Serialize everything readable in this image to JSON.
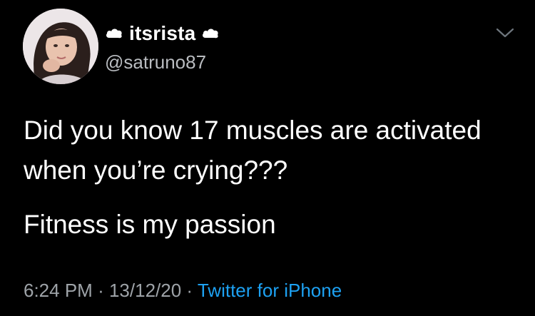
{
  "user": {
    "display_name": "itsrista",
    "handle": "@satruno87",
    "name_decoration_left": "cloud-icon",
    "name_decoration_right": "cloud-icon"
  },
  "tweet": {
    "text_lines": [
      "Did you know 17 muscles are activated",
      "when you’re crying???",
      "Fitness is my passion"
    ],
    "time": "6:24 PM",
    "separator": "·",
    "date": "13/12/20",
    "source": "Twitter for iPhone"
  },
  "icons": {
    "menu": "chevron-down-icon"
  },
  "colors": {
    "background": "#000000",
    "text": "#ffffff",
    "secondary": "#9ea3a8",
    "link": "#1da1f2"
  }
}
